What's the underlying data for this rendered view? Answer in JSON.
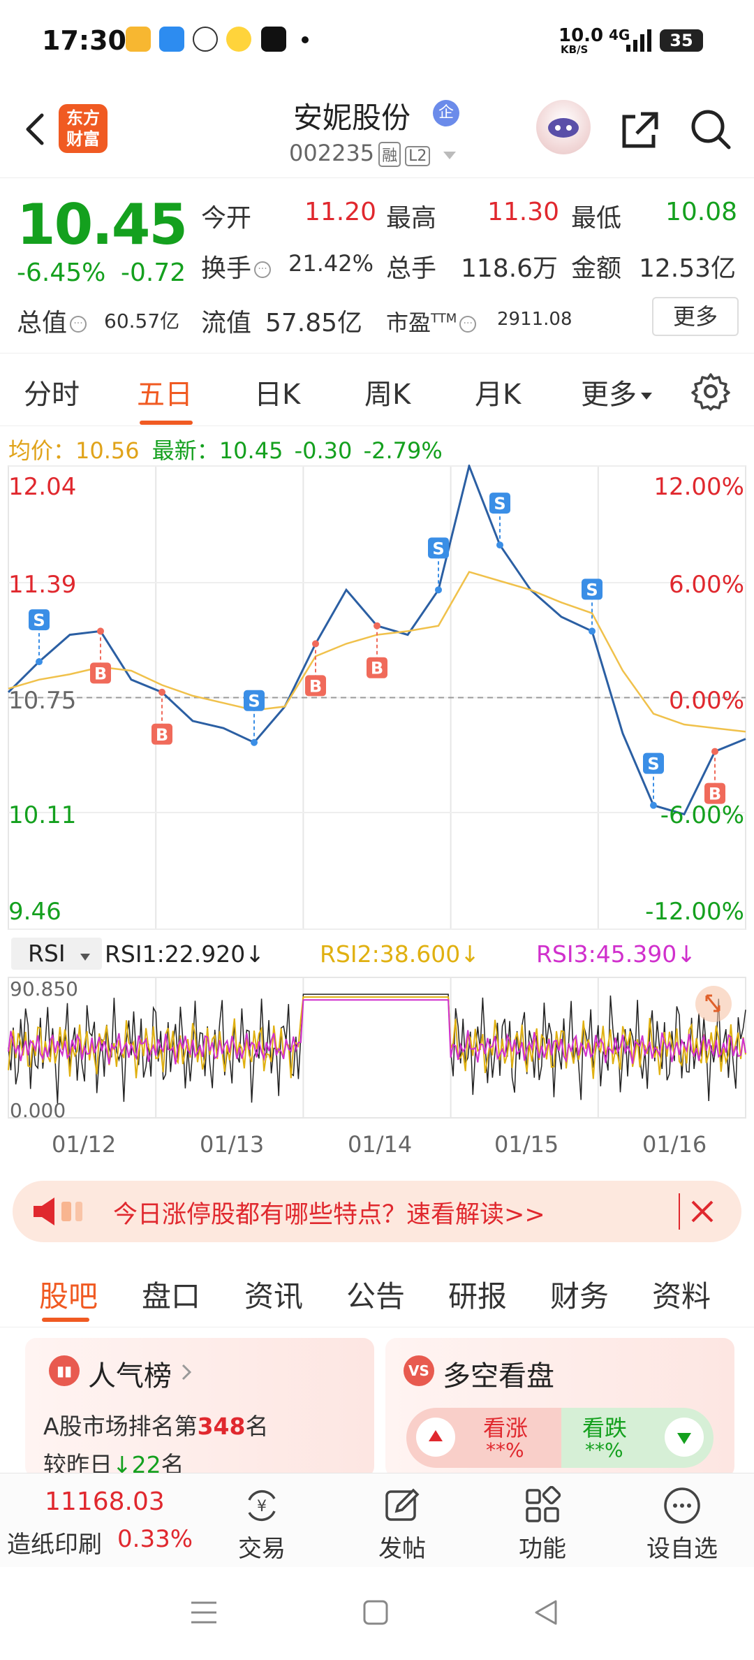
{
  "status_bar": {
    "time": "17:30",
    "net_speed_value": "10.0",
    "net_speed_unit": "KB/S",
    "signal": "4G",
    "battery": "35"
  },
  "header": {
    "back_icon": "chevron-left-icon",
    "logo": "东方\n财富",
    "title": "安妮股份",
    "title_badge": "企",
    "code": "002235",
    "tag1": "融",
    "tag2": "L2"
  },
  "quote": {
    "price": "10.45",
    "change_pct": "-6.45%",
    "change_abs": "-0.72",
    "open_label": "今开",
    "open": "11.20",
    "high_label": "最高",
    "high": "11.30",
    "low_label": "最低",
    "low": "10.08",
    "turnover_label": "换手",
    "turnover": "21.42%",
    "volume_label": "总手",
    "volume": "118.6万",
    "amount_label": "金额",
    "amount": "12.53亿",
    "mktcap_label": "总值",
    "mktcap": "60.57亿",
    "float_label": "流值",
    "float": "57.85亿",
    "pe_label": "市盈",
    "pe_sup": "TTM",
    "pe": "2911.08",
    "more_button": "更多"
  },
  "period_tabs": [
    "分时",
    "五日",
    "日K",
    "周K",
    "月K",
    "更多"
  ],
  "avg_line": {
    "avg_label": "均价：",
    "avg": "10.56",
    "latest_label": "最新：",
    "latest": "10.45",
    "latest_chg": "-0.30",
    "latest_pct": "-2.79%"
  },
  "chart_data": {
    "type": "line",
    "title": "",
    "x": [
      "01/12",
      "01/13",
      "01/14",
      "01/15",
      "01/16"
    ],
    "y_axis_left": [
      "12.04",
      "11.39",
      "10.75",
      "10.11",
      "9.46"
    ],
    "y_axis_right": [
      "12.00%",
      "6.00%",
      "0.00%",
      "-6.00%",
      "-12.00%"
    ],
    "ylim": [
      9.46,
      12.04
    ],
    "reference_price": 10.75,
    "series": [
      {
        "name": "",
        "values": [
          10.78,
          10.95,
          11.1,
          11.12,
          10.85,
          10.78,
          10.62,
          10.58,
          10.5,
          10.7,
          11.05,
          11.35,
          11.15,
          11.1,
          11.35,
          12.04,
          11.6,
          11.35,
          11.2,
          11.12,
          10.55,
          10.15,
          10.1,
          10.45,
          10.52
        ]
      },
      {
        "name": "",
        "values": [
          10.8,
          10.85,
          10.88,
          10.92,
          10.9,
          10.82,
          10.76,
          10.72,
          10.68,
          10.7,
          10.98,
          11.05,
          11.1,
          11.12,
          11.15,
          11.45,
          11.4,
          11.35,
          11.28,
          11.22,
          10.9,
          10.66,
          10.6,
          10.58,
          10.56
        ]
      }
    ],
    "markers": [
      "S",
      "B",
      "B",
      "S",
      "B",
      "B",
      "S",
      "S",
      "S",
      "S",
      "B"
    ]
  },
  "rsi": {
    "selector": "RSI",
    "rsi1": "RSI1:22.920↓",
    "rsi2": "RSI2:38.600↓",
    "rsi3": "RSI3:45.390↓",
    "top": "90.850",
    "bottom": "0.000"
  },
  "dates": [
    "01/12",
    "01/13",
    "01/14",
    "01/15",
    "01/16"
  ],
  "banner": {
    "text": "今日涨停股都有哪些特点？速看解读>>"
  },
  "content_tabs": [
    "股吧",
    "盘口",
    "资讯",
    "公告",
    "研报",
    "财务",
    "资料"
  ],
  "card_popularity": {
    "title": "人气榜",
    "line1_prefix": "A股市场排名第",
    "rank": "348",
    "line1_suffix": "名",
    "line2_prefix": "较昨日",
    "delta": "22",
    "line2_suffix": "名"
  },
  "card_bullbear": {
    "title": "多空看盘",
    "bull_label": "看涨",
    "bull_value": "**%",
    "bear_label": "看跌",
    "bear_value": "**%"
  },
  "bottom_bar": {
    "index_value": "11168.03",
    "index_name": "造纸印刷",
    "index_pct": "0.33%",
    "trade": "交易",
    "post": "发帖",
    "function": "功能",
    "watchlist": "设自选"
  },
  "colors": {
    "accent": "#f05a22",
    "up": "#e0282e",
    "down": "#14a01e",
    "price_line": "#2b5fa3",
    "avg_line": "#f0c14b"
  }
}
